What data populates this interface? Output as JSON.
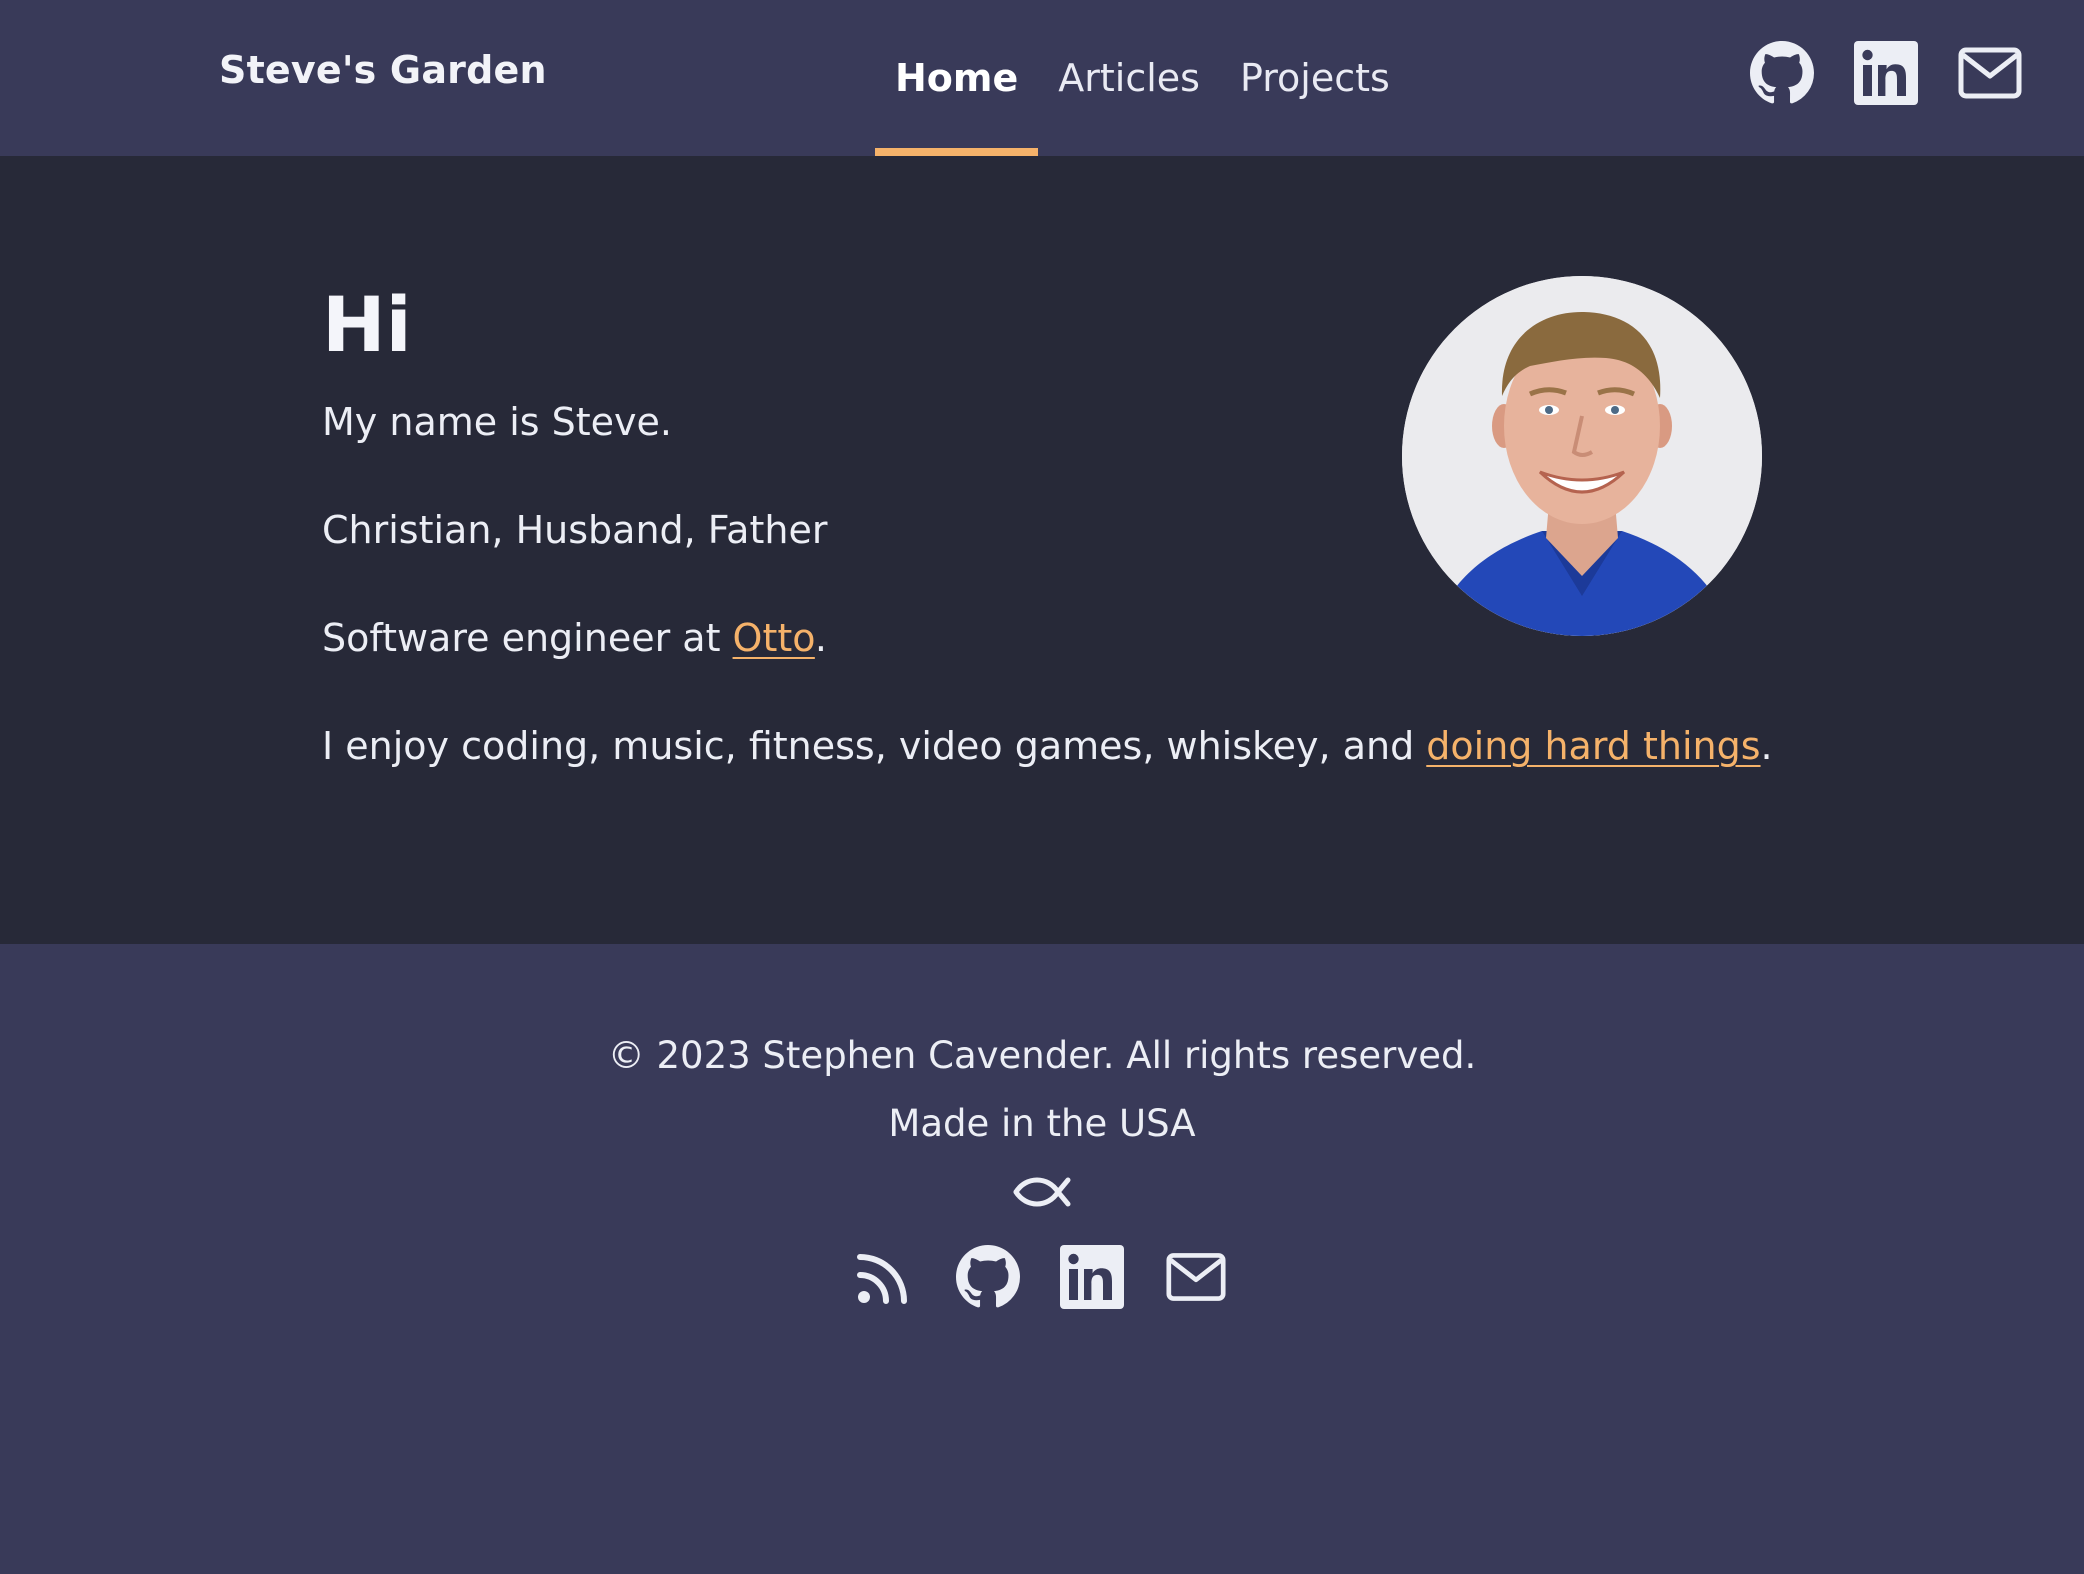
{
  "header": {
    "brand": "Steve's Garden",
    "nav": [
      {
        "label": "Home",
        "active": true
      },
      {
        "label": "Articles",
        "active": false
      },
      {
        "label": "Projects",
        "active": false
      }
    ],
    "icons": [
      "github-icon",
      "linkedin-icon",
      "mail-icon"
    ]
  },
  "main": {
    "title": "Hi",
    "line1": "My name is Steve.",
    "line2": "Christian, Husband, Father",
    "line3_prefix": "Software engineer at ",
    "line3_link": "Otto",
    "line3_suffix": ".",
    "line4_prefix": "I enjoy coding, music, fitness, video games, whiskey, and ",
    "line4_link": "doing hard things",
    "line4_suffix": "."
  },
  "footer": {
    "copyright": "© 2023 Stephen Cavender. All rights reserved.",
    "made_in": "Made in the USA",
    "icons": [
      "ichthys-icon",
      "rss-icon",
      "github-icon",
      "linkedin-icon",
      "mail-icon"
    ]
  },
  "colors": {
    "header_bg": "#393a59",
    "main_bg": "#272938",
    "accent": "#f5b26a",
    "text": "#eceef5"
  }
}
